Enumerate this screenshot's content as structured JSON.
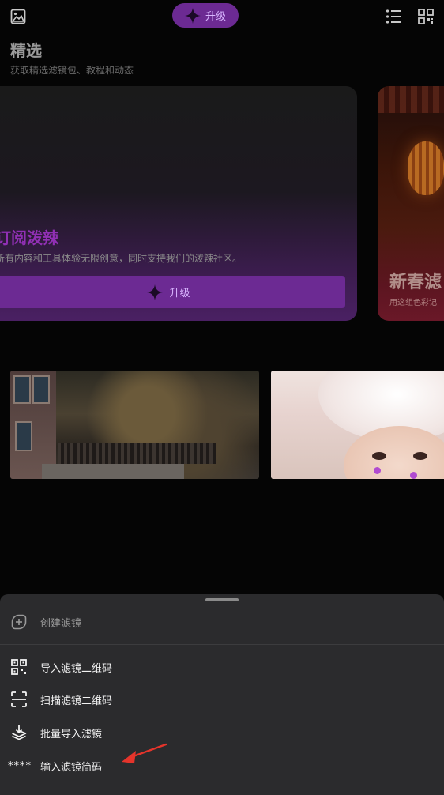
{
  "topbar": {
    "upgrade_label": "升级"
  },
  "section": {
    "title": "精选",
    "subtitle": "获取精选滤镜包、教程和动态"
  },
  "featured_cards": [
    {
      "title": "订阅泼辣",
      "description": "所有内容和工具体验无限创意，同时支持我们的泼辣社区。",
      "cta_label": "升级"
    },
    {
      "title": "新春滤",
      "description": "用这组色彩记"
    }
  ],
  "bottom_sheet": {
    "create_label": "创建滤镜",
    "items": [
      {
        "label": "导入滤镜二维码"
      },
      {
        "label": "扫描滤镜二维码"
      },
      {
        "label": "批量导入滤镜"
      },
      {
        "label": "输入滤镜简码",
        "icon_text": "****"
      }
    ]
  },
  "colors": {
    "accent_purple": "#6c2a93",
    "accent_text": "#d9b6ff",
    "title_purple": "#9130b5",
    "sheet_bg": "#2b2b2d",
    "annotation_arrow": "#e5342b"
  }
}
